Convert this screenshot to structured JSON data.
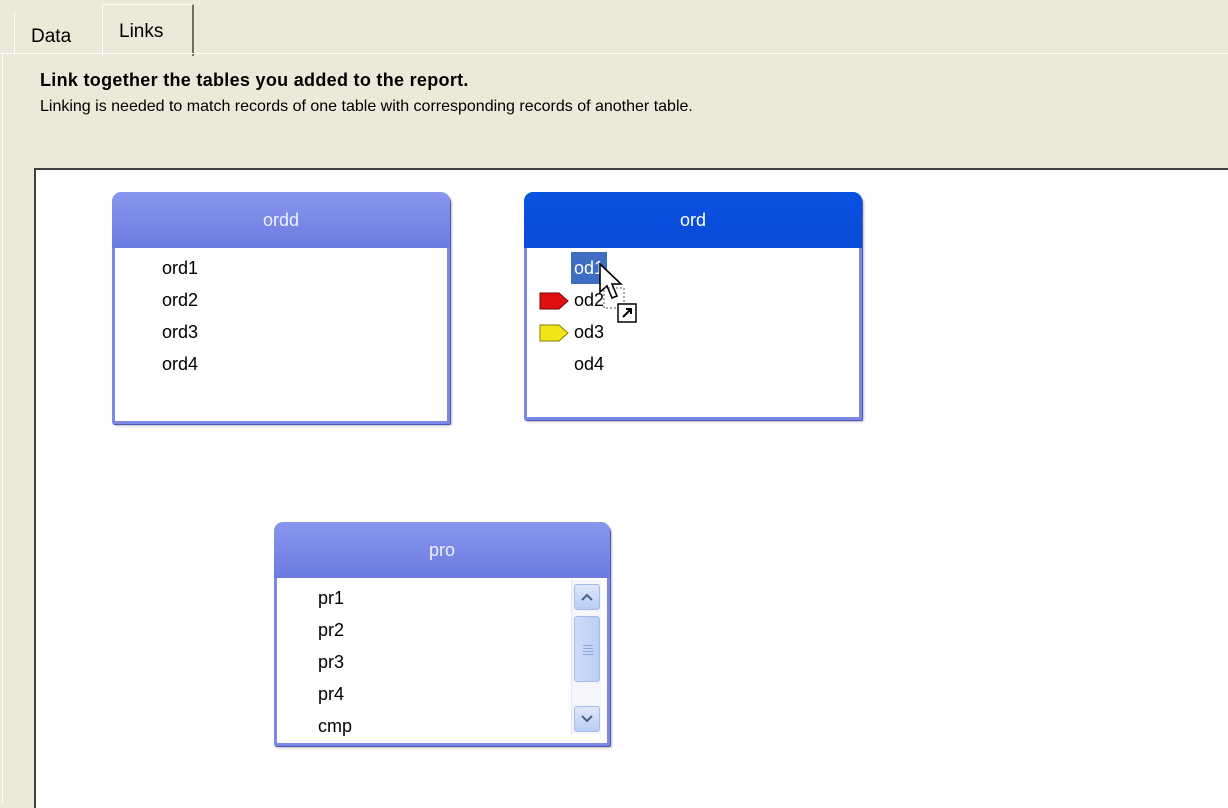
{
  "tabs": [
    {
      "label": "Data"
    },
    {
      "label": "Links",
      "selected": true
    }
  ],
  "heading": "Link together the tables you added to the report.",
  "subheading": "Linking is needed to match records of one table with corresponding records of another table.",
  "tables": {
    "ordd": {
      "title": "ordd",
      "fields": [
        "ord1",
        "ord2",
        "ord3",
        "ord4"
      ]
    },
    "ord": {
      "title": "ord",
      "fields": [
        "od1",
        "od2",
        "od3",
        "od4"
      ],
      "selected_field": "od1",
      "tag_colors": {
        "od2": "#e01010",
        "od3": "#f2e418"
      }
    },
    "pro": {
      "title": "pro",
      "fields": [
        "pr1",
        "pr2",
        "pr3",
        "pr4",
        "cmp"
      ]
    }
  },
  "colors": {
    "header": "#7b88e6",
    "active_header": "#0a52e0",
    "selection": "#3d6ec4"
  }
}
